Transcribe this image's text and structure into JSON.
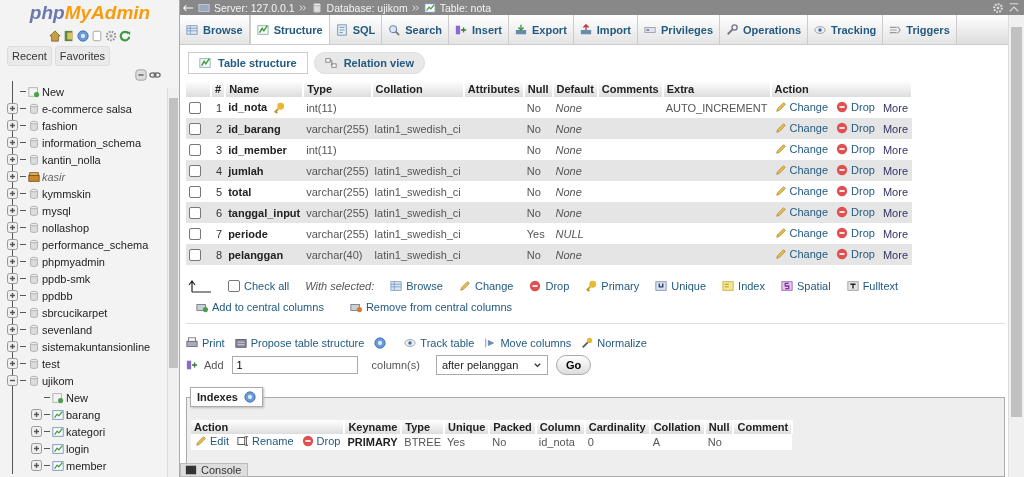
{
  "sidebar": {
    "logo": {
      "prefix": "php",
      "name": "MyAdmin"
    },
    "quick_icons": [
      {
        "kind": "home"
      },
      {
        "kind": "exit"
      },
      {
        "kind": "help"
      },
      {
        "kind": "docs"
      },
      {
        "kind": "settings"
      },
      {
        "kind": "reload"
      }
    ],
    "tabs": [
      {
        "label": "Recent"
      },
      {
        "label": "Favorites"
      }
    ],
    "tree": [
      {
        "label": "New",
        "kind": "new"
      },
      {
        "label": "e-commerce salsa",
        "kind": "database",
        "expanded": false
      },
      {
        "label": "fashion",
        "kind": "database",
        "expanded": false
      },
      {
        "label": "information_schema",
        "kind": "database",
        "expanded": false
      },
      {
        "label": "kantin_nolla",
        "kind": "database",
        "expanded": false
      },
      {
        "label": "kasir",
        "kind": "special",
        "expanded": false
      },
      {
        "label": "kymmskin",
        "kind": "database",
        "expanded": false
      },
      {
        "label": "mysql",
        "kind": "database",
        "expanded": false
      },
      {
        "label": "nollashop",
        "kind": "database",
        "expanded": false
      },
      {
        "label": "performance_schema",
        "kind": "database",
        "expanded": false
      },
      {
        "label": "phpmyadmin",
        "kind": "database",
        "expanded": false
      },
      {
        "label": "ppdb-smk",
        "kind": "database",
        "expanded": false
      },
      {
        "label": "ppdbb",
        "kind": "database",
        "expanded": false
      },
      {
        "label": "sbrcucikarpet",
        "kind": "database",
        "expanded": false
      },
      {
        "label": "sevenland",
        "kind": "database",
        "expanded": false
      },
      {
        "label": "sistemakuntansionline",
        "kind": "database",
        "expanded": false
      },
      {
        "label": "test",
        "kind": "database",
        "expanded": false
      },
      {
        "label": "ujikom",
        "kind": "database",
        "expanded": true,
        "children": [
          {
            "label": "New",
            "kind": "new"
          },
          {
            "label": "barang",
            "kind": "table",
            "expanded": false
          },
          {
            "label": "kategori",
            "kind": "table",
            "expanded": false
          },
          {
            "label": "login",
            "kind": "table",
            "expanded": false
          },
          {
            "label": "member",
            "kind": "table",
            "expanded": false
          }
        ]
      }
    ]
  },
  "breadcrumb": [
    {
      "label": "Server: 127.0.0.1",
      "kind": "server"
    },
    {
      "label": "Database: ujikom",
      "kind": "database"
    },
    {
      "label": "Table: nota",
      "kind": "table"
    }
  ],
  "tabs": [
    {
      "label": "Browse",
      "kind": "browse",
      "selected": false
    },
    {
      "label": "Structure",
      "kind": "structure",
      "selected": true
    },
    {
      "label": "SQL",
      "kind": "sql",
      "selected": false
    },
    {
      "label": "Search",
      "kind": "search",
      "selected": false
    },
    {
      "label": "Insert",
      "kind": "insert",
      "selected": false
    },
    {
      "label": "Export",
      "kind": "export",
      "selected": false
    },
    {
      "label": "Import",
      "kind": "import",
      "selected": false
    },
    {
      "label": "Privileges",
      "kind": "privileges",
      "selected": false
    },
    {
      "label": "Operations",
      "kind": "operations",
      "selected": false
    },
    {
      "label": "Tracking",
      "kind": "tracking",
      "selected": false
    },
    {
      "label": "Triggers",
      "kind": "triggers",
      "selected": false
    }
  ],
  "subtabs": [
    {
      "label": "Table structure",
      "kind": "structure",
      "selected": true
    },
    {
      "label": "Relation view",
      "kind": "relation",
      "selected": false
    }
  ],
  "columns_table": {
    "columns": [
      "#",
      "Name",
      "Type",
      "Collation",
      "Attributes",
      "Null",
      "Default",
      "Comments",
      "Extra",
      "Action"
    ],
    "rows": [
      {
        "checked": false,
        "number": "1",
        "name": "id_nota",
        "primary": true,
        "type": "int(11)",
        "null": "No",
        "default": "None",
        "extra": "AUTO_INCREMENT",
        "actions": [
          {
            "label": "Change",
            "kind": "change"
          },
          {
            "label": "Drop",
            "kind": "drop"
          },
          {
            "label": "More",
            "kind": "more"
          }
        ]
      },
      {
        "checked": false,
        "number": "2",
        "name": "id_barang",
        "primary": false,
        "type": "varchar(255)",
        "collation": "latin1_swedish_ci",
        "null": "No",
        "default": "None",
        "actions": [
          {
            "label": "Change",
            "kind": "change"
          },
          {
            "label": "Drop",
            "kind": "drop"
          },
          {
            "label": "More",
            "kind": "more"
          }
        ]
      },
      {
        "checked": false,
        "number": "3",
        "name": "id_member",
        "primary": false,
        "type": "int(11)",
        "null": "No",
        "default": "None",
        "actions": [
          {
            "label": "Change",
            "kind": "change"
          },
          {
            "label": "Drop",
            "kind": "drop"
          },
          {
            "label": "More",
            "kind": "more"
          }
        ]
      },
      {
        "checked": false,
        "number": "4",
        "name": "jumlah",
        "primary": false,
        "type": "varchar(255)",
        "collation": "latin1_swedish_ci",
        "null": "No",
        "default": "None",
        "actions": [
          {
            "label": "Change",
            "kind": "change"
          },
          {
            "label": "Drop",
            "kind": "drop"
          },
          {
            "label": "More",
            "kind": "more"
          }
        ]
      },
      {
        "checked": false,
        "number": "5",
        "name": "total",
        "primary": false,
        "type": "varchar(255)",
        "collation": "latin1_swedish_ci",
        "null": "No",
        "default": "None",
        "actions": [
          {
            "label": "Change",
            "kind": "change"
          },
          {
            "label": "Drop",
            "kind": "drop"
          },
          {
            "label": "More",
            "kind": "more"
          }
        ]
      },
      {
        "checked": false,
        "number": "6",
        "name": "tanggal_input",
        "primary": false,
        "type": "varchar(255)",
        "collation": "latin1_swedish_ci",
        "null": "No",
        "default": "None",
        "actions": [
          {
            "label": "Change",
            "kind": "change"
          },
          {
            "label": "Drop",
            "kind": "drop"
          },
          {
            "label": "More",
            "kind": "more"
          }
        ]
      },
      {
        "checked": false,
        "number": "7",
        "name": "periode",
        "primary": false,
        "type": "varchar(255)",
        "collation": "latin1_swedish_ci",
        "null": "Yes",
        "default": "NULL",
        "actions": [
          {
            "label": "Change",
            "kind": "change"
          },
          {
            "label": "Drop",
            "kind": "drop"
          },
          {
            "label": "More",
            "kind": "more"
          }
        ]
      },
      {
        "checked": false,
        "number": "8",
        "name": "pelanggan",
        "primary": false,
        "type": "varchar(40)",
        "collation": "latin1_swedish_ci",
        "null": "No",
        "default": "None",
        "actions": [
          {
            "label": "Change",
            "kind": "change"
          },
          {
            "label": "Drop",
            "kind": "drop"
          },
          {
            "label": "More",
            "kind": "more"
          }
        ]
      }
    ]
  },
  "bulk": {
    "check_all": {
      "label": "Check all",
      "checked": false
    },
    "with_selected": "With selected:",
    "actions": [
      {
        "label": "Browse",
        "kind": "browse"
      },
      {
        "label": "Change",
        "kind": "change"
      },
      {
        "label": "Drop",
        "kind": "drop"
      },
      {
        "label": "Primary",
        "kind": "primary"
      },
      {
        "label": "Unique",
        "kind": "unique"
      },
      {
        "label": "Index",
        "kind": "index"
      },
      {
        "label": "Spatial",
        "kind": "spatial"
      },
      {
        "label": "Fulltext",
        "kind": "fulltext"
      }
    ],
    "central": [
      {
        "label": "Add to central columns",
        "kind": "central_add"
      },
      {
        "label": "Remove from central columns",
        "kind": "central_remove"
      }
    ]
  },
  "tools": [
    {
      "label": "Print",
      "kind": "print"
    },
    {
      "label": "Propose table structure",
      "kind": "propose",
      "help": true
    },
    {
      "label": "Track table",
      "kind": "tracking"
    },
    {
      "label": "Move columns",
      "kind": "move"
    },
    {
      "label": "Normalize",
      "kind": "normalize"
    }
  ],
  "add_columns": {
    "label": "Add",
    "value": "1",
    "unit": "column(s)",
    "position": "after pelanggan",
    "button": "Go"
  },
  "indexes": {
    "title": "Indexes",
    "columns": [
      "Action",
      "Keyname",
      "Type",
      "Unique",
      "Packed",
      "Column",
      "Cardinality",
      "Collation",
      "Null",
      "Comment"
    ],
    "rows": [
      {
        "actions": [
          {
            "label": "Edit",
            "kind": "change"
          },
          {
            "label": "Rename",
            "kind": "rename"
          },
          {
            "label": "Drop",
            "kind": "drop"
          }
        ],
        "keyname": "PRIMARY",
        "type": "BTREE",
        "unique": "Yes",
        "packed": "No",
        "column": "id_nota",
        "cardinality": "0",
        "collation": "A",
        "null": "No"
      }
    ]
  },
  "console": {
    "label": "Console"
  }
}
